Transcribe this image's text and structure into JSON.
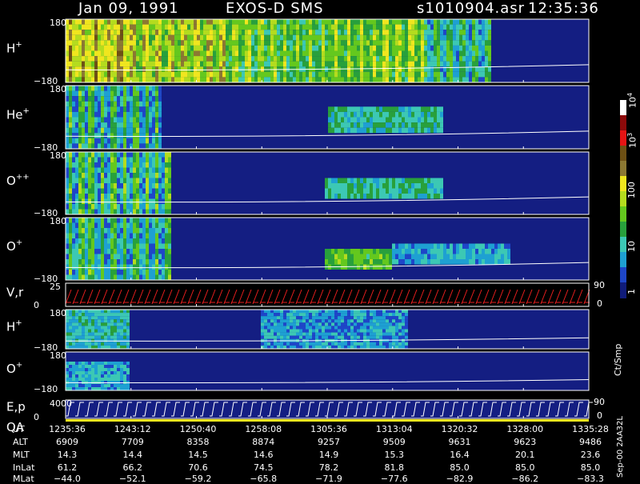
{
  "header": {
    "date": "Jan 09, 1991",
    "mission": "EXOS-D SMS",
    "file": "s1010904.asr",
    "time": "12:35:36"
  },
  "side_label": "Sep-00 2AA32L",
  "chart_data": {
    "type": "heatmap",
    "panels": [
      {
        "label": "H",
        "sup": "+",
        "ytop": "180",
        "ybot": "−180",
        "ylim": [
          -180,
          180
        ]
      },
      {
        "label": "He",
        "sup": "+",
        "ytop": "180",
        "ybot": "−180",
        "ylim": [
          -180,
          180
        ]
      },
      {
        "label": "O",
        "sup": "++",
        "ytop": "180",
        "ybot": "−180",
        "ylim": [
          -180,
          180
        ]
      },
      {
        "label": "O",
        "sup": "+",
        "ytop": "180",
        "ybot": "−180",
        "ylim": [
          -180,
          180
        ]
      },
      {
        "label": "V,r",
        "sup": "",
        "ytop": "25",
        "ybot": "0",
        "ylim": [
          0,
          25
        ],
        "right_top": "90",
        "right_bot": "0"
      },
      {
        "label": "H",
        "sup": "+",
        "ytop": "180",
        "ybot": "−180",
        "ylim": [
          -180,
          180
        ]
      },
      {
        "label": "O",
        "sup": "+",
        "ytop": "180",
        "ybot": "−180",
        "ylim": [
          -180,
          180
        ]
      },
      {
        "label": "E,p",
        "label2": "QA",
        "sup": "",
        "ytop": "4000",
        "ybot": "0",
        "ylim": [
          0,
          4000
        ],
        "right_top": "90",
        "right_bot": "0"
      }
    ],
    "colorbar": {
      "unit": "Ct/Smp",
      "scale": "log",
      "range": [
        1,
        10000
      ],
      "ticks": [
        {
          "mant": "1",
          "exp": ""
        },
        {
          "mant": "10",
          "exp": ""
        },
        {
          "mant": "100",
          "exp": ""
        },
        {
          "mant": "10",
          "exp": "3"
        },
        {
          "mant": "10",
          "exp": "4"
        }
      ],
      "colors": [
        "#101c7a",
        "#1e46c8",
        "#1ea0d2",
        "#3cc8b4",
        "#28a03c",
        "#64c81e",
        "#b4dc1e",
        "#f0e61e",
        "#8c7832",
        "#6e5014",
        "#e61414",
        "#8c0a0a",
        "#ffffff"
      ]
    },
    "ephemeris": {
      "columns": [
        "1235:36",
        "1243:12",
        "1250:40",
        "1258:08",
        "1305:36",
        "1313:04",
        "1320:32",
        "1328:00",
        "1335:28"
      ],
      "rows": [
        {
          "label": "UT",
          "values": [
            "1235:36",
            "1243:12",
            "1250:40",
            "1258:08",
            "1305:36",
            "1313:04",
            "1320:32",
            "1328:00",
            "1335:28"
          ]
        },
        {
          "label": "ALT",
          "values": [
            "6909",
            "7709",
            "8358",
            "8874",
            "9257",
            "9509",
            "9631",
            "9623",
            "9486"
          ]
        },
        {
          "label": "MLT",
          "values": [
            "14.3",
            "14.4",
            "14.5",
            "14.6",
            "14.9",
            "15.3",
            "16.4",
            "20.1",
            "23.6"
          ]
        },
        {
          "label": "InLat",
          "values": [
            "61.2",
            "66.2",
            "70.6",
            "74.5",
            "78.2",
            "81.8",
            "85.0",
            "85.0",
            "85.0"
          ]
        },
        {
          "label": "MLat",
          "values": [
            "−44.0",
            "−52.1",
            "−59.2",
            "−65.8",
            "−71.9",
            "−77.6",
            "−82.9",
            "−86.2",
            "−83.3"
          ]
        }
      ]
    }
  }
}
